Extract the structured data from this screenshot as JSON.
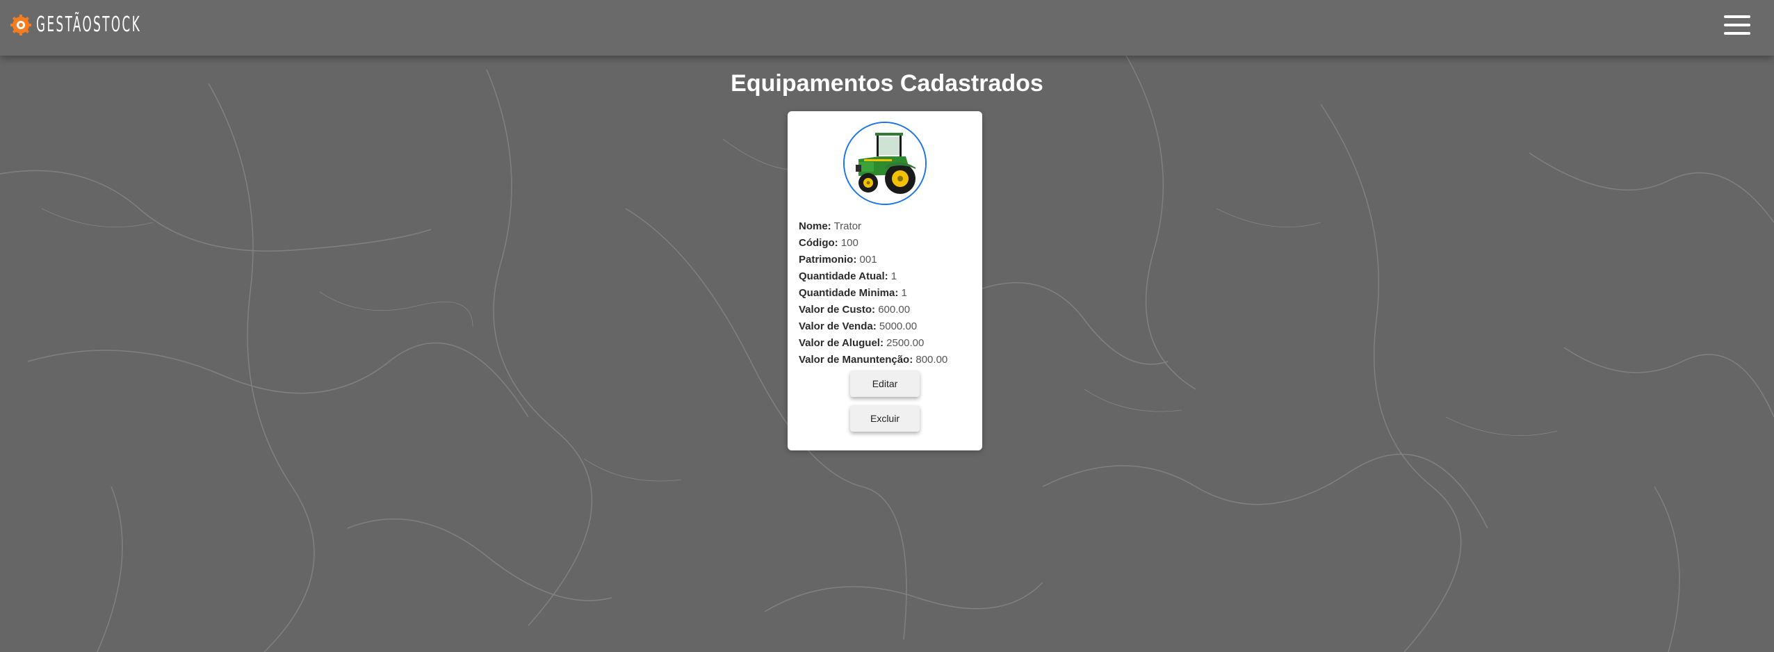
{
  "header": {
    "logo_text": "GESTÃOSTOCK",
    "logo_icon": "gear-icon",
    "menu_icon": "hamburger-menu-icon",
    "accent_color": "#f57c1f"
  },
  "main": {
    "title": "Equipamentos Cadastrados"
  },
  "equipment_card": {
    "image": "tractor-image",
    "image_border_color": "#1a73e8",
    "fields": [
      {
        "label": "Nome:",
        "value": "Trator"
      },
      {
        "label": "Código:",
        "value": "100"
      },
      {
        "label": "Patrimonio:",
        "value": "001"
      },
      {
        "label": "Quantidade Atual:",
        "value": "1"
      },
      {
        "label": "Quantidade Minima:",
        "value": "1"
      },
      {
        "label": "Valor de Custo:",
        "value": "600.00"
      },
      {
        "label": "Valor de Venda:",
        "value": "5000.00"
      },
      {
        "label": "Valor de Aluguel:",
        "value": "2500.00"
      },
      {
        "label": "Valor de Manuntenção:",
        "value": "800.00"
      }
    ],
    "edit_label": "Editar",
    "delete_label": "Excluir"
  }
}
